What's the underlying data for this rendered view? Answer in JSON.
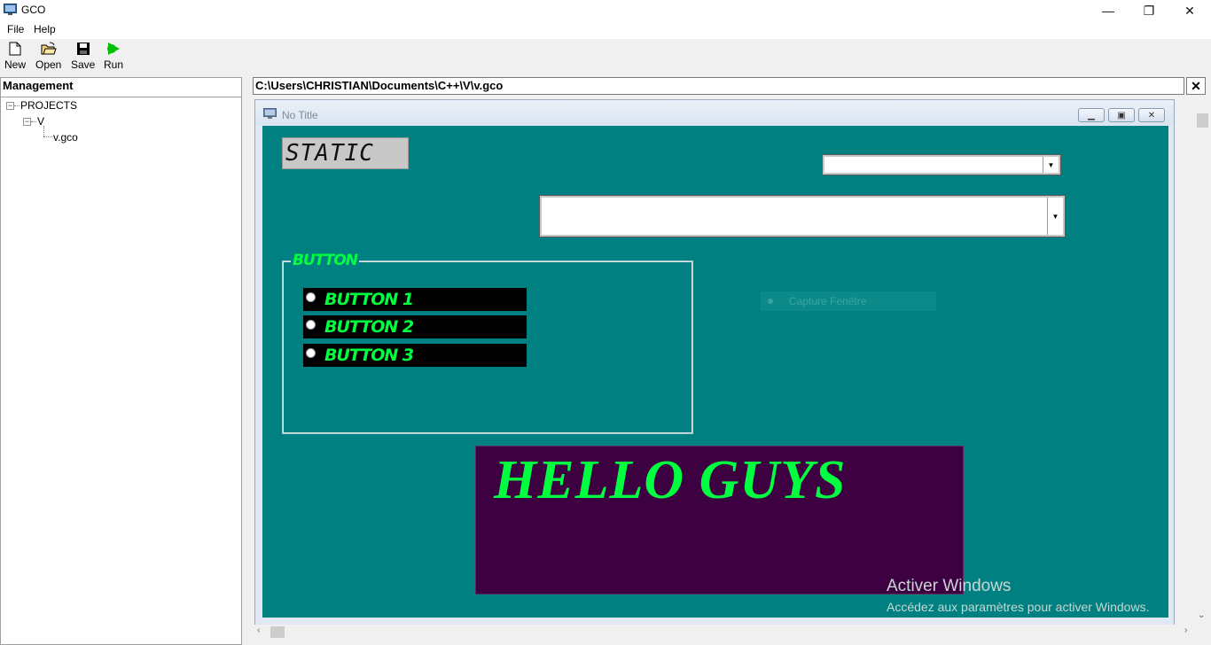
{
  "window": {
    "title": "GCO",
    "minimize_glyph": "—",
    "restore_glyph": "❐",
    "close_glyph": "✕"
  },
  "menu": {
    "items": [
      {
        "label": "File"
      },
      {
        "label": "Help"
      }
    ]
  },
  "toolbar": {
    "items": [
      {
        "label": "New",
        "icon": "new-file-icon"
      },
      {
        "label": "Open",
        "icon": "open-folder-icon"
      },
      {
        "label": "Save",
        "icon": "save-disk-icon"
      },
      {
        "label": "Run",
        "icon": "run-icon"
      }
    ]
  },
  "management": {
    "header": "Management",
    "tree": {
      "root": "PROJECTS",
      "project": "V",
      "file": "v.gco"
    }
  },
  "editor": {
    "path": "C:\\Users\\CHRISTIAN\\Documents\\C++\\V\\v.gco",
    "close_glyph": "✕",
    "form": {
      "title": "No Title",
      "static_text": "STATIC",
      "group_label": "BUTTON",
      "radio_buttons": [
        {
          "label": "BUTTON 1"
        },
        {
          "label": "BUTTON 2"
        },
        {
          "label": "BUTTON 3"
        }
      ],
      "capture_label": "Capture Fenêtre",
      "hello_text": "HELLO GUYS"
    }
  },
  "watermark": {
    "title": "Activer Windows",
    "subtitle": "Accédez aux paramètres pour activer Windows."
  },
  "colors": {
    "form_background": "#008080",
    "accent_green": "#00ff40",
    "hello_background": "#3d0040"
  }
}
